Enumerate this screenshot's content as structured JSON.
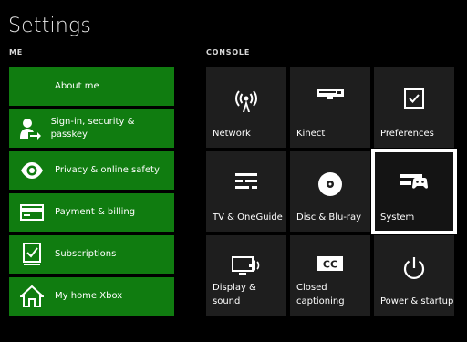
{
  "page": {
    "title": "Settings"
  },
  "sections": {
    "me": "ME",
    "console": "CONSOLE"
  },
  "me_items": [
    {
      "label": "About me",
      "icon": "none"
    },
    {
      "label": "Sign-in, security & passkey",
      "icon": "person-arrow-icon"
    },
    {
      "label": "Privacy & online safety",
      "icon": "eye-icon"
    },
    {
      "label": "Payment & billing",
      "icon": "credit-card-icon"
    },
    {
      "label": "Subscriptions",
      "icon": "checklist-icon"
    },
    {
      "label": "My home Xbox",
      "icon": "home-icon"
    }
  ],
  "console_tiles": [
    {
      "label": "Network",
      "icon": "wireless-icon"
    },
    {
      "label": "Kinect",
      "icon": "kinect-sensor-icon"
    },
    {
      "label": "Preferences",
      "icon": "checkbox-icon"
    },
    {
      "label": "TV & OneGuide",
      "icon": "tv-guide-icon"
    },
    {
      "label": "Disc & Blu-ray",
      "icon": "disc-icon"
    },
    {
      "label": "System",
      "icon": "console-controller-icon",
      "focused": true
    },
    {
      "label": "Display & sound",
      "icon": "display-sound-icon"
    },
    {
      "label": "Closed captioning",
      "icon": "closed-caption-icon"
    },
    {
      "label": "Power & startup",
      "icon": "power-icon"
    }
  ],
  "colors": {
    "accent_green": "#107c10",
    "tile_bg": "#1e1e1e",
    "background": "#000000",
    "focus": "#ffffff"
  }
}
